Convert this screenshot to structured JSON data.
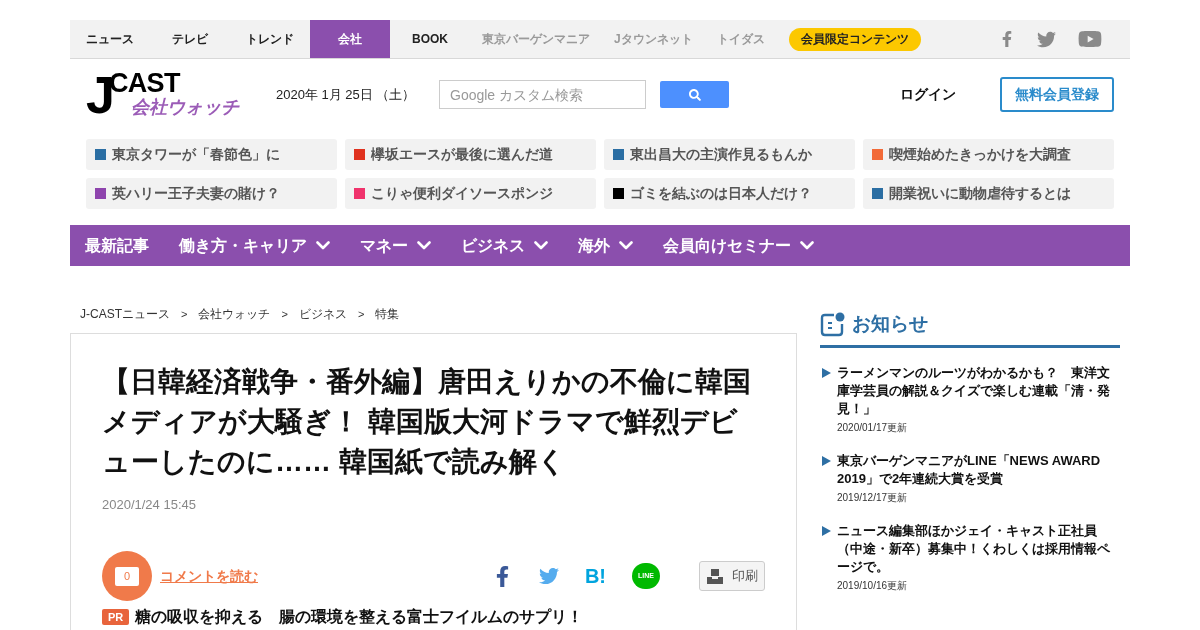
{
  "top_nav": {
    "items": [
      {
        "label": "ニュース",
        "kind": "main",
        "selected": false
      },
      {
        "label": "テレビ",
        "kind": "main",
        "selected": false
      },
      {
        "label": "トレンド",
        "kind": "main",
        "selected": false
      },
      {
        "label": "会社",
        "kind": "main",
        "selected": true
      },
      {
        "label": "BOOK",
        "kind": "main",
        "selected": false
      },
      {
        "label": "東京バーゲンマニア",
        "kind": "partner",
        "selected": false
      },
      {
        "label": "Jタウンネット",
        "kind": "partner",
        "selected": false
      },
      {
        "label": "トイダス",
        "kind": "partner",
        "selected": false
      },
      {
        "label": "会員限定コンテンツ",
        "kind": "badge",
        "selected": false
      }
    ]
  },
  "header": {
    "logo": {
      "initial": "J",
      "name": "CAST",
      "subtitle": "会社ウォッチ"
    },
    "date": "2020年 1月 25日 （土）",
    "search": {
      "placeholder": "Google カスタム検索"
    },
    "login": "ログイン",
    "register": "無料会員登録"
  },
  "trending": [
    {
      "label": "東京タワーが「春節色」に",
      "color": "#2b6ea3"
    },
    {
      "label": "欅坂エースが最後に選んだ道",
      "color": "#e0321f"
    },
    {
      "label": "東出昌大の主演作見るもんか",
      "color": "#2b6ea3"
    },
    {
      "label": "喫煙始めたきっかけを大調査",
      "color": "#f26a38"
    },
    {
      "label": "英ハリー王子夫妻の賭け？",
      "color": "#8e44ad"
    },
    {
      "label": "こりゃ便利ダイソースポンジ",
      "color": "#f0336c"
    },
    {
      "label": "ゴミを結ぶのは日本人だけ？",
      "color": "#000000"
    },
    {
      "label": "開業祝いに動物虐待するとは",
      "color": "#2b6ea3"
    }
  ],
  "category_nav": [
    {
      "label": "最新記事",
      "dropdown": false
    },
    {
      "label": "働き方・キャリア",
      "dropdown": true
    },
    {
      "label": "マネー",
      "dropdown": true
    },
    {
      "label": "ビジネス",
      "dropdown": true
    },
    {
      "label": "海外",
      "dropdown": true
    },
    {
      "label": "会員向けセミナー",
      "dropdown": true
    }
  ],
  "breadcrumb": [
    {
      "label": "J-CASTニュース",
      "separator": ">"
    },
    {
      "label": "会社ウォッチ",
      "separator": ">"
    },
    {
      "label": "ビジネス",
      "separator": ">"
    },
    {
      "label": "特集"
    }
  ],
  "article": {
    "title": "【日韓経済戦争・番外編】唐田えりかの不倫に韓国メディアが大騒ぎ！ 韓国版大河ドラマで鮮烈デビューしたのに…… 韓国紙で読み解く",
    "date": "2020/1/24 15:45",
    "comments": {
      "count": "0",
      "link": "コメントを読む"
    },
    "share": {
      "hatena": "B!",
      "line": "LINE"
    },
    "print": "印刷",
    "promo": {
      "badge": "PR",
      "text": "糖の吸収を抑える　腸の環境を整える富士フイルムのサプリ！"
    }
  },
  "sidebar": {
    "title": "お知らせ",
    "items": [
      {
        "text": "ラーメンマンのルーツがわかるかも？　東洋文庫学芸員の解説＆クイズで楽しむ連載「清・発見！」",
        "date": "2020/01/17更新"
      },
      {
        "text": "東京バーゲンマニアがLINE「NEWS AWARD 2019」で2年連続大賞を受賞",
        "date": "2019/12/17更新"
      },
      {
        "text": "ニュース編集部ほかジェイ・キャスト正社員（中途・新卒）募集中！くわしくは採用情報ページで。",
        "date": "2019/10/16更新"
      }
    ]
  }
}
